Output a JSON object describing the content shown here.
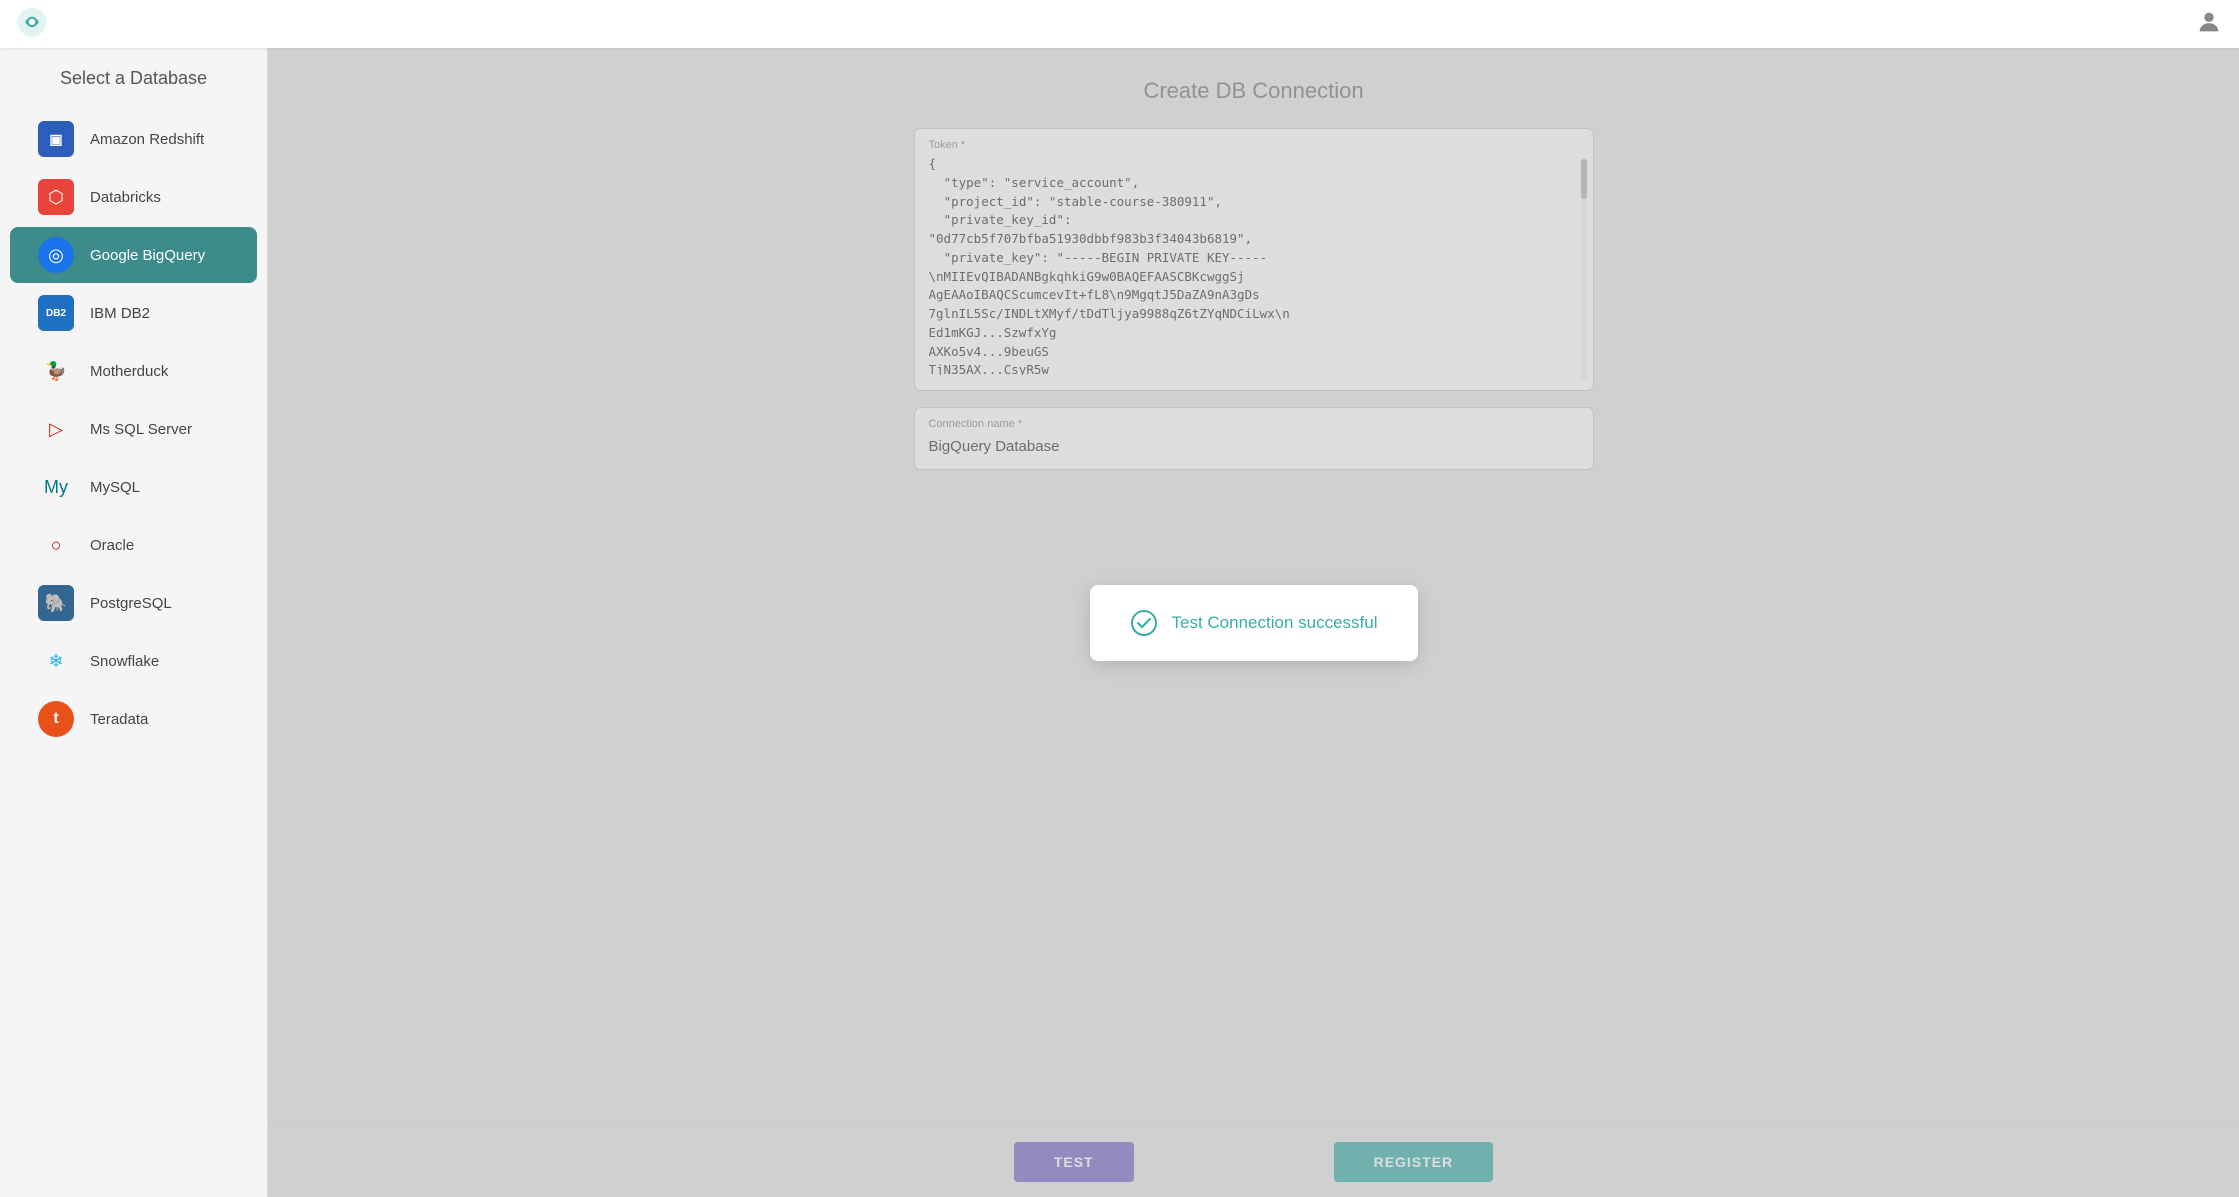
{
  "header": {
    "logo_alt": "App Logo",
    "user_icon_alt": "User Account"
  },
  "sidebar": {
    "title": "Select a Database",
    "items": [
      {
        "id": "amazon-redshift",
        "label": "Amazon Redshift",
        "icon_text": "▣",
        "icon_class": "icon-redshift",
        "active": false
      },
      {
        "id": "databricks",
        "label": "Databricks",
        "icon_text": "⬡",
        "icon_class": "icon-databricks",
        "active": false
      },
      {
        "id": "google-bigquery",
        "label": "Google BigQuery",
        "icon_text": "◎",
        "icon_class": "icon-bigquery",
        "active": true
      },
      {
        "id": "ibm-db2",
        "label": "IBM DB2",
        "icon_text": "DB2",
        "icon_class": "icon-ibmdb2",
        "active": false
      },
      {
        "id": "motherduck",
        "label": "Motherduck",
        "icon_text": "🦆",
        "icon_class": "icon-motherduck",
        "active": false
      },
      {
        "id": "ms-sql-server",
        "label": "Ms SQL Server",
        "icon_text": "▷",
        "icon_class": "icon-mssql",
        "active": false
      },
      {
        "id": "mysql",
        "label": "MySQL",
        "icon_text": "My",
        "icon_class": "icon-mysql",
        "active": false
      },
      {
        "id": "oracle",
        "label": "Oracle",
        "icon_text": "○",
        "icon_class": "icon-oracle",
        "active": false
      },
      {
        "id": "postgresql",
        "label": "PostgreSQL",
        "icon_text": "🐘",
        "icon_class": "icon-postgresql",
        "active": false
      },
      {
        "id": "snowflake",
        "label": "Snowflake",
        "icon_text": "❄",
        "icon_class": "icon-snowflake",
        "active": false
      },
      {
        "id": "teradata",
        "label": "Teradata",
        "icon_text": "t",
        "icon_class": "icon-teradata",
        "active": false
      }
    ]
  },
  "main": {
    "page_title": "Create DB Connection",
    "token_label": "Token *",
    "token_value": "{\n  \"type\": \"service_account\",\n  \"project_id\": \"stable-course-380911\",\n  \"private_key_id\":\n\"0d77cb5f707bfba51930dbbf983b3f34043b6819\",\n  \"private_key\": \"-----BEGIN PRIVATE KEY-----\n\\nMIIEvQIBADANBgkqhkiG9w0BAQEFAASCBKcwggSj\nAgEAAoIBAQCScumcevIt+fL8\\n9MgqtJ5DaZA9nA3gDs\n7glnIL5Sc/INDLtXMyf/tDdTljya9988qZ6tZYqNDCiLwx\\n\nEd1mKGJ...SzwfxYg\nAXKo5v4...9beuGS\nTjN35AX...CsyR5w",
    "connection_name_label": "Connection name *",
    "connection_name_value": "BigQuery Database"
  },
  "toast": {
    "text": "Test Connection successful"
  },
  "footer": {
    "test_label": "TEST",
    "register_label": "REGISTER"
  }
}
